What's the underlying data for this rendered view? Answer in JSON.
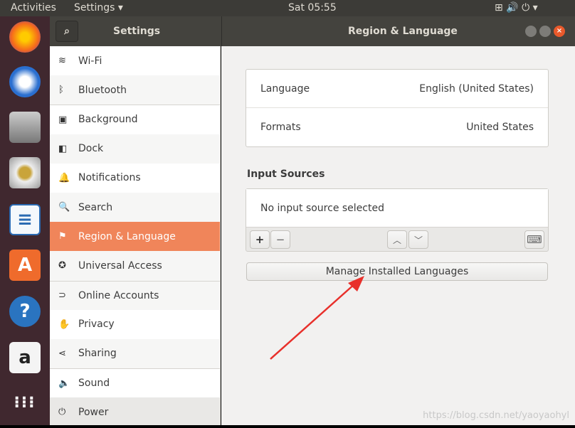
{
  "topbar": {
    "activities": "Activities",
    "app_menu": "Settings ▾",
    "clock": "Sat 05:55",
    "status_icons": "⊞ 🔊 ⏻ ▾"
  },
  "dock": {
    "apps": [
      "firefox",
      "thunderbird",
      "files",
      "rhythmbox",
      "libreoffice-writer",
      "software-center",
      "help",
      "amazon",
      "show-apps"
    ]
  },
  "header": {
    "left_title": "Settings",
    "right_title": "Region & Language"
  },
  "sidebar": {
    "items": [
      {
        "label": "Wi-Fi",
        "icon": "wifi-icon",
        "glyph": "≋"
      },
      {
        "label": "Bluetooth",
        "icon": "bluetooth-icon",
        "glyph": "ᛒ"
      },
      {
        "label": "Background",
        "icon": "background-icon",
        "glyph": "▣"
      },
      {
        "label": "Dock",
        "icon": "dock-icon",
        "glyph": "◧"
      },
      {
        "label": "Notifications",
        "icon": "bell-icon",
        "glyph": "🔔"
      },
      {
        "label": "Search",
        "icon": "search-icon",
        "glyph": "🔍"
      },
      {
        "label": "Region & Language",
        "icon": "flag-icon",
        "glyph": "⚑"
      },
      {
        "label": "Universal Access",
        "icon": "accessibility-icon",
        "glyph": "✪"
      },
      {
        "label": "Online Accounts",
        "icon": "online-accounts-icon",
        "glyph": "⊃"
      },
      {
        "label": "Privacy",
        "icon": "hand-icon",
        "glyph": "✋"
      },
      {
        "label": "Sharing",
        "icon": "share-icon",
        "glyph": "⋖"
      },
      {
        "label": "Sound",
        "icon": "speaker-icon",
        "glyph": "🔈"
      },
      {
        "label": "Power",
        "icon": "power-plug-icon",
        "glyph": "⏻"
      }
    ]
  },
  "main": {
    "language_label": "Language",
    "language_value": "English (United States)",
    "formats_label": "Formats",
    "formats_value": "United States",
    "input_sources_title": "Input Sources",
    "no_input": "No input source selected",
    "add": "+",
    "remove": "−",
    "up": "︿",
    "down": "﹀",
    "keyboard": "⌨",
    "manage_button": "Manage Installed Languages"
  },
  "watermark": "https://blog.csdn.net/yaoyaohyl",
  "colors": {
    "accent": "#f0855a",
    "arrow": "#e8302b"
  }
}
